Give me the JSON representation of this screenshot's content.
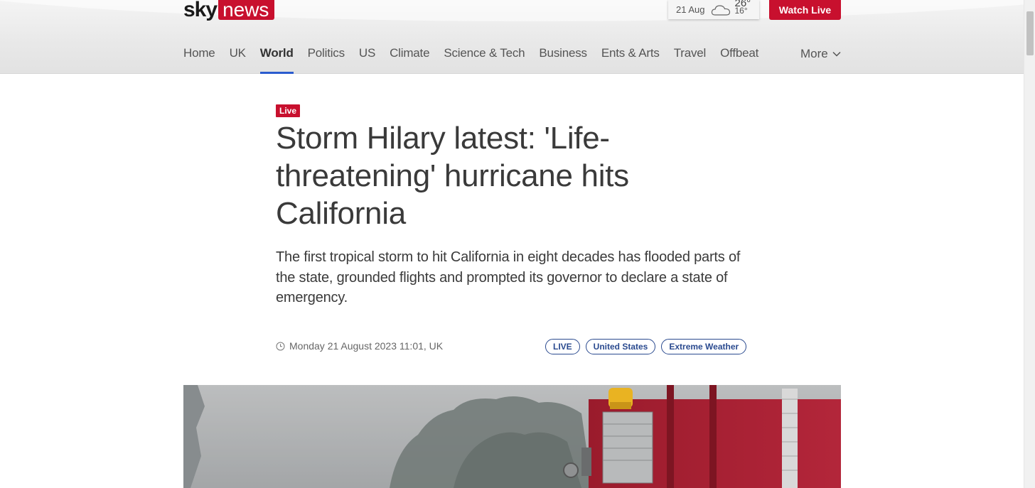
{
  "header": {
    "logo": {
      "sky": "sky",
      "news": "news"
    },
    "weather": {
      "date": "21 Aug",
      "icon": "cloud-icon",
      "high": "26°",
      "low": "16°"
    },
    "watch_live_label": "Watch Live",
    "nav": [
      {
        "label": "Home",
        "active": false
      },
      {
        "label": "UK",
        "active": false
      },
      {
        "label": "World",
        "active": true
      },
      {
        "label": "Politics",
        "active": false
      },
      {
        "label": "US",
        "active": false
      },
      {
        "label": "Climate",
        "active": false
      },
      {
        "label": "Science & Tech",
        "active": false
      },
      {
        "label": "Business",
        "active": false
      },
      {
        "label": "Ents & Arts",
        "active": false
      },
      {
        "label": "Travel",
        "active": false
      },
      {
        "label": "Offbeat",
        "active": false
      }
    ],
    "more_label": "More"
  },
  "article": {
    "badge": "Live",
    "headline": "Storm Hilary latest: 'Life-threatening' hurricane hits California",
    "standfirst": "The first tropical storm to hit California in eight decades has flooded parts of the state, grounded flights and prompted its governor to declare a state of emergency.",
    "dateline": "Monday 21 August 2023 11:01, UK",
    "tags": [
      "LIVE",
      "United States",
      "Extreme Weather"
    ]
  },
  "colors": {
    "brand_red": "#c8102e",
    "active_underline": "#2a5ccf",
    "tag_blue": "#2a4a8f"
  }
}
